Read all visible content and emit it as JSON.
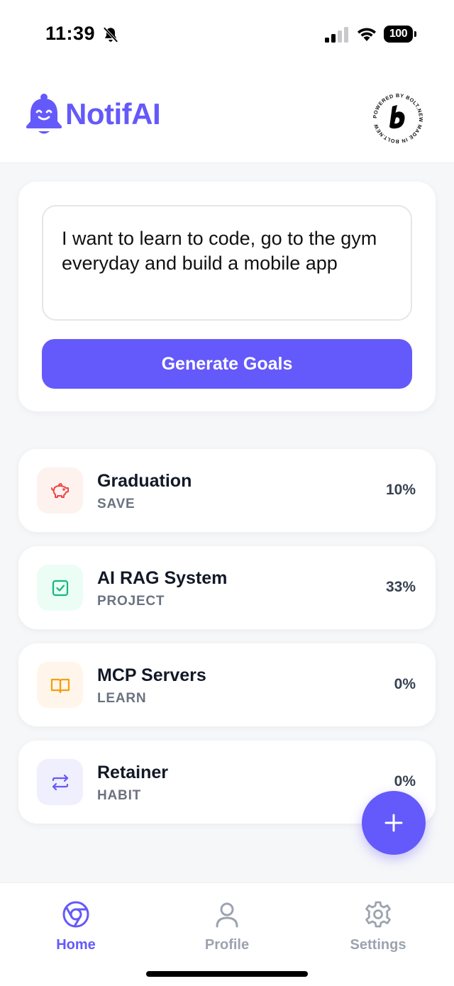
{
  "status_bar": {
    "time": "11:39",
    "battery": "100",
    "icons": [
      "bell-slash-icon",
      "signal-icon",
      "wifi-icon",
      "battery-icon"
    ]
  },
  "header": {
    "app_name": "NotifAI",
    "logo_icon": "smiling-bell-icon",
    "badge_icon": "bolt-new-badge-icon",
    "badge_text": "POWERED BY BOLT.NEW MADE IN BOLT.NEW"
  },
  "input": {
    "value": "I want to learn to code, go to the gym everyday and build a mobile app"
  },
  "generate_button": {
    "label": "Generate Goals"
  },
  "goals": [
    {
      "title": "Graduation",
      "category": "SAVE",
      "percent": "10%",
      "icon": "piggy-bank-icon",
      "color": "#ef4444",
      "bg": "#fef2ef"
    },
    {
      "title": "AI RAG System",
      "category": "PROJECT",
      "percent": "33%",
      "icon": "checkbox-icon",
      "color": "#10b981",
      "bg": "#ecfdf6"
    },
    {
      "title": "MCP Servers",
      "category": "LEARN",
      "percent": "0%",
      "icon": "book-icon",
      "color": "#f59e0b",
      "bg": "#fff5ea"
    },
    {
      "title": "Retainer",
      "category": "HABIT",
      "percent": "0%",
      "icon": "repeat-arrows-icon",
      "color": "#6459fa",
      "bg": "#efeffe"
    }
  ],
  "fab": {
    "icon": "plus-icon"
  },
  "nav": {
    "items": [
      {
        "label": "Home",
        "icon": "chrome-icon",
        "active": true
      },
      {
        "label": "Profile",
        "icon": "user-icon",
        "active": false
      },
      {
        "label": "Settings",
        "icon": "gear-icon",
        "active": false
      }
    ]
  },
  "colors": {
    "accent": "#6459fa",
    "background": "#f6f7f9",
    "inactive": "#9ca3af"
  }
}
